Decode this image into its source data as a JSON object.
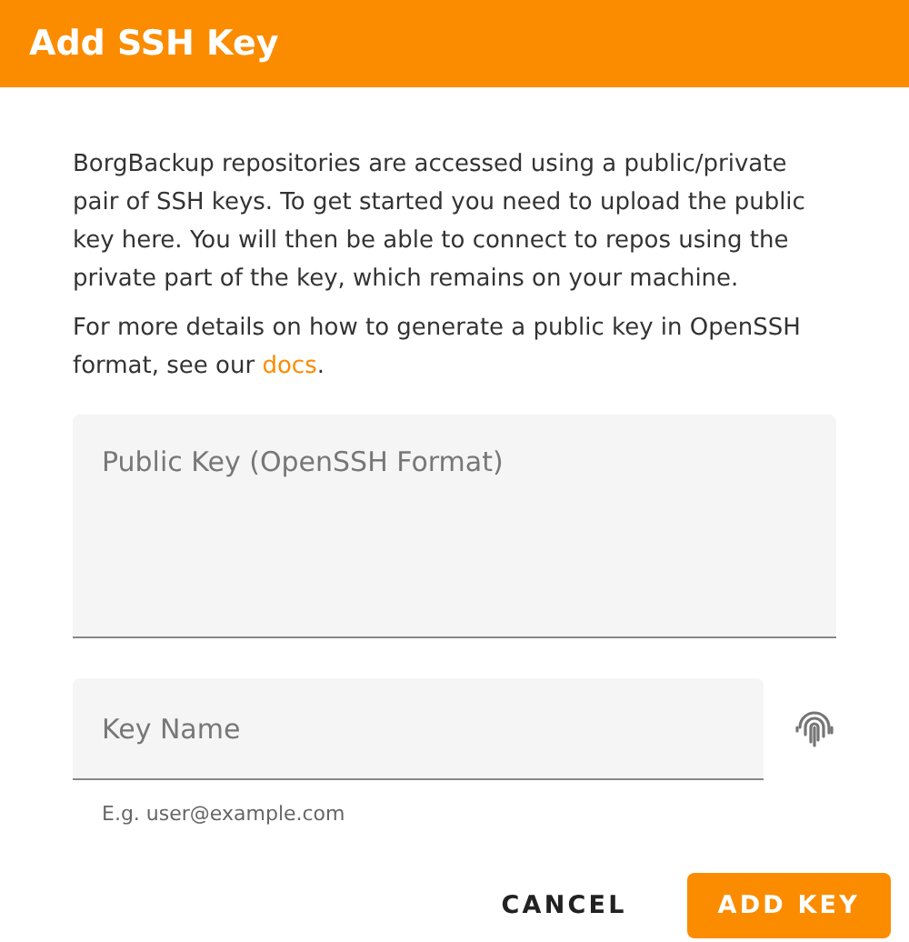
{
  "dialog": {
    "title": "Add SSH Key"
  },
  "intro": "BorgBackup repositories are accessed using a public/private pair of SSH keys. To get started you need to upload the public key here. You will then be able to connect to repos using the private part of the key, which remains on your machine.",
  "details": {
    "before": "For more details on how to generate a public key in OpenSSH format, see our ",
    "link": "docs",
    "after": "."
  },
  "public_key": {
    "placeholder": "Public Key (OpenSSH Format)"
  },
  "key_name": {
    "placeholder": "Key Name",
    "hint": "E.g. user@example.com"
  },
  "buttons": [
    {
      "label": "CANCEL",
      "kind": "text"
    },
    {
      "label": "ADD KEY",
      "kind": "primary"
    }
  ]
}
